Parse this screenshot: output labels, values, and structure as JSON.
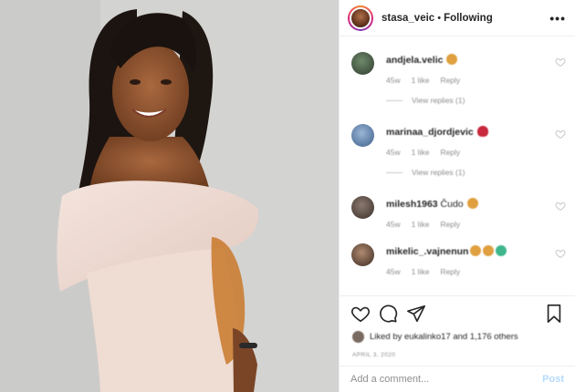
{
  "post": {
    "username": "stasa_veic",
    "follow_status": "Following",
    "more_label": "•••"
  },
  "comments": [
    {
      "username": "andjela.velic",
      "text": "",
      "emoji": [
        "#e0a040"
      ],
      "age": "45w",
      "likes": "1 like",
      "reply": "Reply",
      "view_replies": "View replies (1)"
    },
    {
      "username": "marinaa_djordjevic",
      "text": "",
      "emoji": [
        "#c8283c"
      ],
      "age": "45w",
      "likes": "1 like",
      "reply": "Reply",
      "view_replies": "View replies (1)"
    },
    {
      "username": "milesh1963",
      "text": "Čudo",
      "emoji": [
        "#e0a040"
      ],
      "age": "45w",
      "likes": "1 like",
      "reply": "Reply",
      "view_replies": ""
    },
    {
      "username": "mikelic_.vajnenun",
      "text": "",
      "emoji": [
        "#e0a040",
        "#e0a040",
        "#3fb68b"
      ],
      "age": "45w",
      "likes": "1 like",
      "reply": "Reply",
      "view_replies": ""
    }
  ],
  "actions": {
    "liked_by": "Liked by eukalinko17 and 1,176 others",
    "date": "APRIL 3, 2020"
  },
  "add_comment": {
    "placeholder": "Add a comment...",
    "post_label": "Post"
  },
  "icons": [
    "heart-icon",
    "comment-icon",
    "share-icon",
    "bookmark-icon",
    "more-icon"
  ],
  "colors": {
    "link_inactive": "#b3dbff",
    "muted": "#8e8e8e",
    "text": "#262626",
    "border": "#efefef"
  }
}
